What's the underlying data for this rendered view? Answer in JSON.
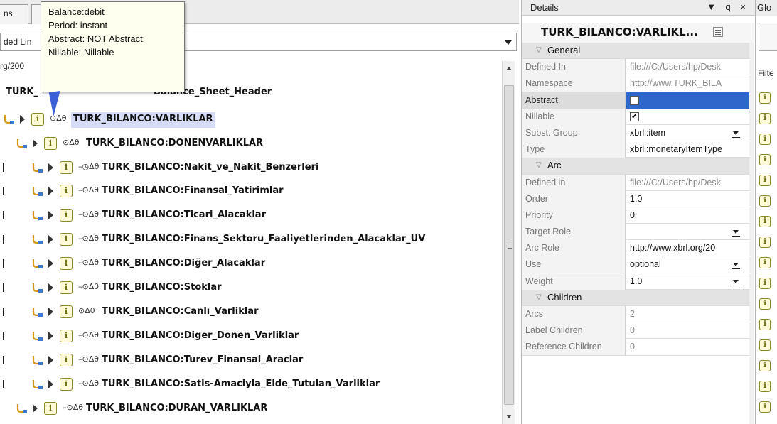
{
  "tabs": {
    "left_tab": "ns",
    "linkbar_text": "ded Lin"
  },
  "tree": {
    "namespace_fragment": "rg/200",
    "root_label_prefix": "TURK_",
    "root_label_suffix": "Balance_Sheet_Header",
    "mods_full": "–⦵☼Δθ",
    "items": [
      {
        "label": "TURK_BILANCO:VARLIKLAR",
        "mods": "⊙Δθ",
        "selected": true
      },
      {
        "label": "TURK_BILANCO:DONENVARLIKLAR",
        "mods": "⊙Δθ"
      },
      {
        "label": "TURK_BILANCO:Nakit_ve_Nakit_Benzerleri",
        "mods": "–◷Δθ"
      },
      {
        "label": "TURK_BILANCO:Finansal_Yatirimlar",
        "mods": "–⊙Δθ"
      },
      {
        "label": "TURK_BILANCO:Ticari_Alacaklar",
        "mods": "–⊙Δθ"
      },
      {
        "label": "TURK_BILANCO:Finans_Sektoru_Faaliyetlerinden_Alacaklar_UV",
        "mods": "–⊙Δθ"
      },
      {
        "label": "TURK_BILANCO:Diğer_Alacaklar",
        "mods": "–⊙Δθ"
      },
      {
        "label": "TURK_BILANCO:Stoklar",
        "mods": "–⊙Δθ"
      },
      {
        "label": "TURK_BILANCO:Canlı_Varliklar",
        "mods": "⊙Δθ"
      },
      {
        "label": "TURK_BILANCO:Diger_Donen_Varliklar",
        "mods": "–⊙Δθ"
      },
      {
        "label": "TURK_BILANCO:Turev_Finansal_Araclar",
        "mods": "–⊙Δθ"
      },
      {
        "label": "TURK_BILANCO:Satis-Amaciyla_Elde_Tutulan_Varliklar",
        "mods": "–⊙Δθ"
      },
      {
        "label": "TURK_BILANCO:DURAN_VARLIKLAR",
        "mods": "–⊙Δθ"
      }
    ]
  },
  "tooltip": {
    "balance": "Balance:debit",
    "period": "Period:  instant",
    "abstract": "Abstract: NOT Abstract",
    "nillable": "Nillable: Nillable"
  },
  "details": {
    "panel_title": "Details",
    "panel_controls": "▼ q ×",
    "name": "TURK_BILANCO:VARLIKL...",
    "general": {
      "label": "General",
      "rows": [
        {
          "key": "Defined In",
          "value": "file:///C:/Users/hp/Desk",
          "grey": true
        },
        {
          "key": "Namespace",
          "value": "http://www.TURK_BILA",
          "grey": true
        },
        {
          "key": "Abstract",
          "value": "",
          "kind": "checkbox",
          "checked": false,
          "selected": true
        },
        {
          "key": "Nillable",
          "value": "✔",
          "kind": "checkbox",
          "checked": true
        },
        {
          "key": "Subst. Group",
          "value": "xbrli:item",
          "kind": "dropdown"
        },
        {
          "key": "Type",
          "value": "xbrli:monetaryItemType"
        }
      ]
    },
    "arc": {
      "label": "Arc",
      "rows": [
        {
          "key": "Defined in",
          "value": "file:///C:/Users/hp/Desk",
          "grey": true
        },
        {
          "key": "Order",
          "value": "1.0"
        },
        {
          "key": "Priority",
          "value": "0"
        },
        {
          "key": "Target Role",
          "value": "",
          "kind": "dropdown"
        },
        {
          "key": "Arc Role",
          "value": "http://www.xbrl.org/20"
        },
        {
          "key": "Use",
          "value": "optional",
          "kind": "dropdown"
        },
        {
          "key": "Weight",
          "value": "1.0",
          "kind": "dropdown"
        }
      ]
    },
    "children": {
      "label": "Children",
      "rows": [
        {
          "key": "Arcs",
          "value": "2",
          "grey": true
        },
        {
          "key": "Label Children",
          "value": "0",
          "grey": true
        },
        {
          "key": "Reference Children",
          "value": "0",
          "grey": true
        }
      ]
    }
  },
  "global": {
    "title": "Glo",
    "filter_label": "Filte"
  },
  "icons": {
    "item_glyph": "i",
    "category_glyph": "▽"
  },
  "colors": {
    "selection_blue": "#2e66cc",
    "tooltip_bg": "#fffff0",
    "item_icon_border": "#8a8a2a"
  }
}
